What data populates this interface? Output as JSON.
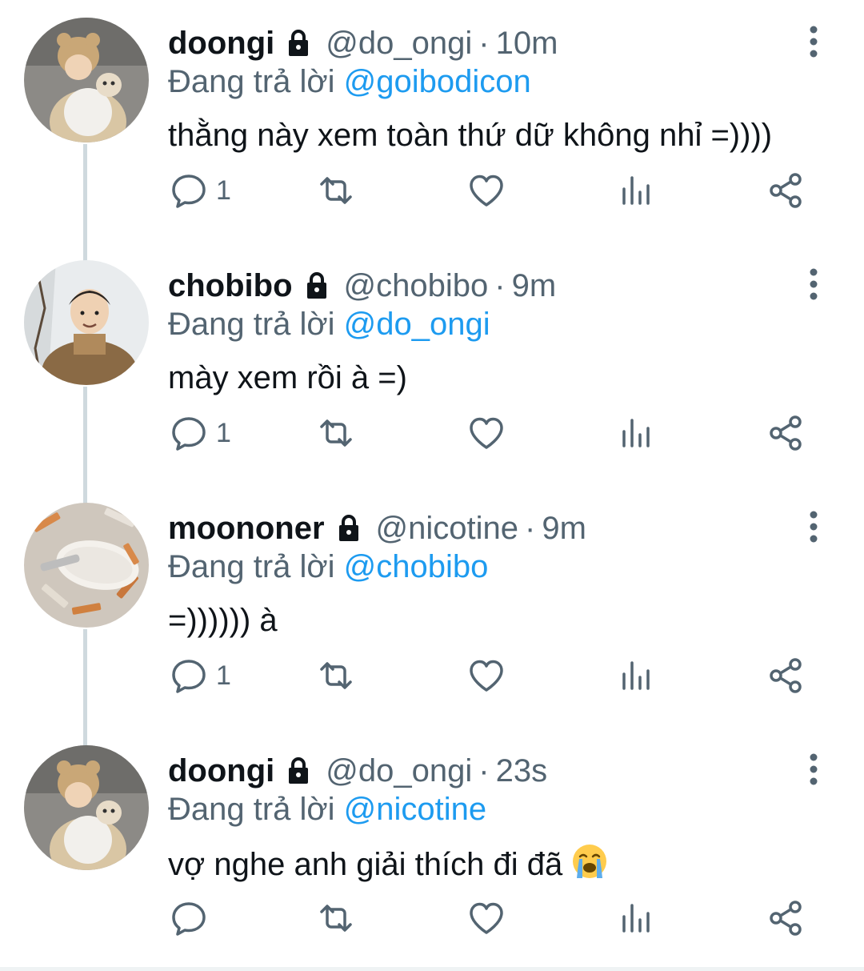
{
  "tweets": [
    {
      "username": "doongi",
      "handle": "@do_ongi",
      "separator": "·",
      "time": "10m",
      "replying_prefix": "Đang trả lời",
      "replying_to": "@goibodicon",
      "text": "thằng này xem toàn thứ dữ không nhỉ =))))",
      "reply_count": "1",
      "avatar": "avatar-doongi"
    },
    {
      "username": "chobibo",
      "handle": "@chobibo",
      "separator": "·",
      "time": "9m",
      "replying_prefix": "Đang trả lời",
      "replying_to": "@do_ongi",
      "text": "mày xem rồi à =)",
      "reply_count": "1",
      "avatar": "avatar-chobibo"
    },
    {
      "username": "moononer",
      "handle": "@nicotine",
      "separator": "·",
      "time": "9m",
      "replying_prefix": "Đang trả lời",
      "replying_to": "@chobibo",
      "text": "=)))))) à",
      "reply_count": "1",
      "avatar": "avatar-cigarettes"
    },
    {
      "username": "doongi",
      "handle": "@do_ongi",
      "separator": "·",
      "time": "23s",
      "replying_prefix": "Đang trả lời",
      "replying_to": "@nicotine",
      "text": "vợ nghe anh giải thích đi đã",
      "reply_count": "",
      "avatar": "avatar-doongi",
      "emoji": "loudly-crying-face"
    }
  ],
  "colors": {
    "text": "#0f1419",
    "secondary": "#536471",
    "mention": "#1d9bf0",
    "thread_line": "#cfd9de"
  },
  "icons": [
    "lock-icon",
    "more-icon",
    "reply-icon",
    "retweet-icon",
    "like-icon",
    "views-icon",
    "share-icon"
  ]
}
